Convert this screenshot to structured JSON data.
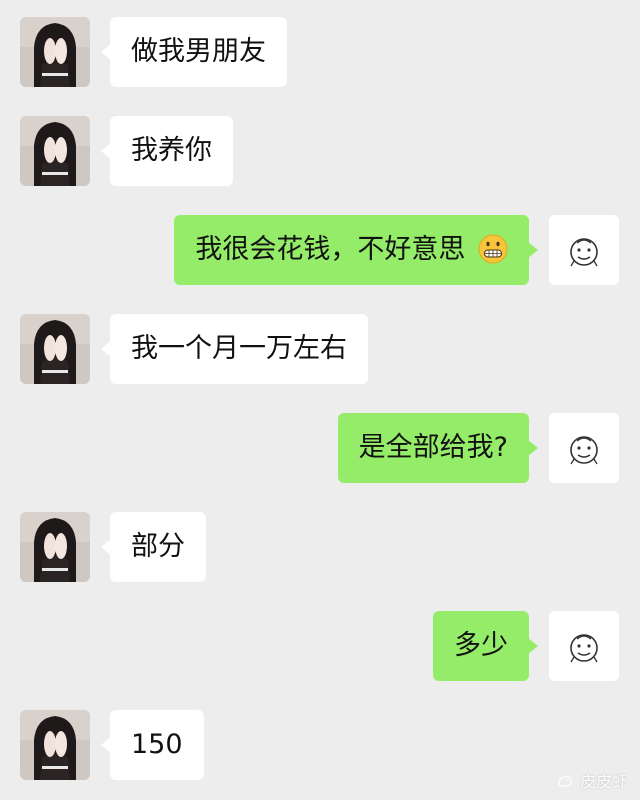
{
  "chat": {
    "messages": [
      {
        "sender": "other",
        "text": "做我男朋友"
      },
      {
        "sender": "other",
        "text": "我养你"
      },
      {
        "sender": "self",
        "text": "我很会花钱，不好意思",
        "emoji": "grimacing-face-emoji"
      },
      {
        "sender": "other",
        "text": "我一个月一万左右"
      },
      {
        "sender": "self",
        "text": "是全部给我?"
      },
      {
        "sender": "other",
        "text": "部分"
      },
      {
        "sender": "self",
        "text": "多少"
      },
      {
        "sender": "other",
        "text": "150"
      }
    ],
    "avatars": {
      "other": "girl-covering-face-avatar",
      "self": "sketch-face-avatar"
    }
  },
  "watermark": {
    "text": "皮皮虾",
    "icon": "shrimp-icon"
  },
  "colors": {
    "background": "#ededed",
    "incoming_bubble": "#ffffff",
    "outgoing_bubble": "#95ec69",
    "text": "#111111"
  }
}
